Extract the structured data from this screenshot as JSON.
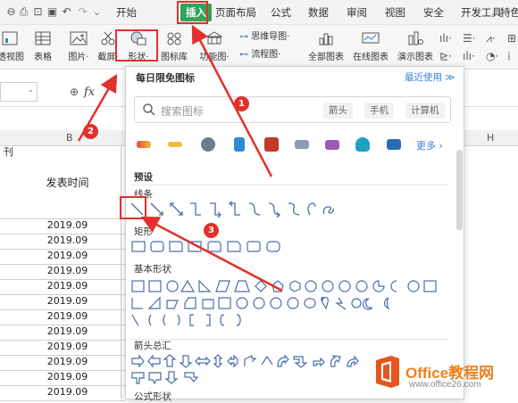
{
  "menu": {
    "tabs": [
      "开始",
      "插入",
      "页面布局",
      "公式",
      "数据",
      "审阅",
      "视图",
      "安全",
      "开发工具",
      "特色"
    ],
    "active": "插入"
  },
  "ribbon": {
    "left_items": [
      "透视图",
      "表格",
      "图片·",
      "截屏·",
      "形状·",
      "图标库",
      "功能图·"
    ],
    "small_items": [
      "思维导图·",
      "流程图·"
    ],
    "right_items": [
      "全部图表",
      "在线图表",
      "演示图表"
    ]
  },
  "formula": {
    "fx": "fx"
  },
  "sheet": {
    "col_headers": [
      "B",
      "H"
    ],
    "left_fragment": "刊",
    "header_cell": "发表时间",
    "rows": [
      "2019.09",
      "2019.09",
      "2019.09",
      "2019.09",
      "2019.09",
      "2019.09",
      "2019.09",
      "2019.09",
      "2019.09",
      "2019.09",
      "2019.09",
      "2019.09"
    ]
  },
  "panel": {
    "title": "每日限免图标",
    "recent": "最近使用 ≫",
    "search_placeholder": "搜索图标",
    "tags": [
      "箭头",
      "手机",
      "计算机"
    ],
    "more": "更多 ›",
    "sections": {
      "preset": "预设",
      "lines": "线条",
      "rect": "矩形",
      "basic": "基本形状",
      "arrows": "箭头总汇",
      "formula": "公式形状"
    },
    "feature_icons": [
      "year-2020-icon",
      "year-2020-red-icon",
      "lantern-icon",
      "card-icon",
      "couple-icon",
      "monitor-icon",
      "book-icon",
      "cloud-icon",
      "computer-icon"
    ]
  },
  "annotations": [
    "1",
    "2",
    "3"
  ],
  "watermark": {
    "brand": "Office教程网",
    "url": "www.office26.com"
  },
  "colors": {
    "accent": "#31a35a",
    "highlight": "#e3302b",
    "link": "#3b7fd8",
    "watermark": "#f07f1b"
  }
}
